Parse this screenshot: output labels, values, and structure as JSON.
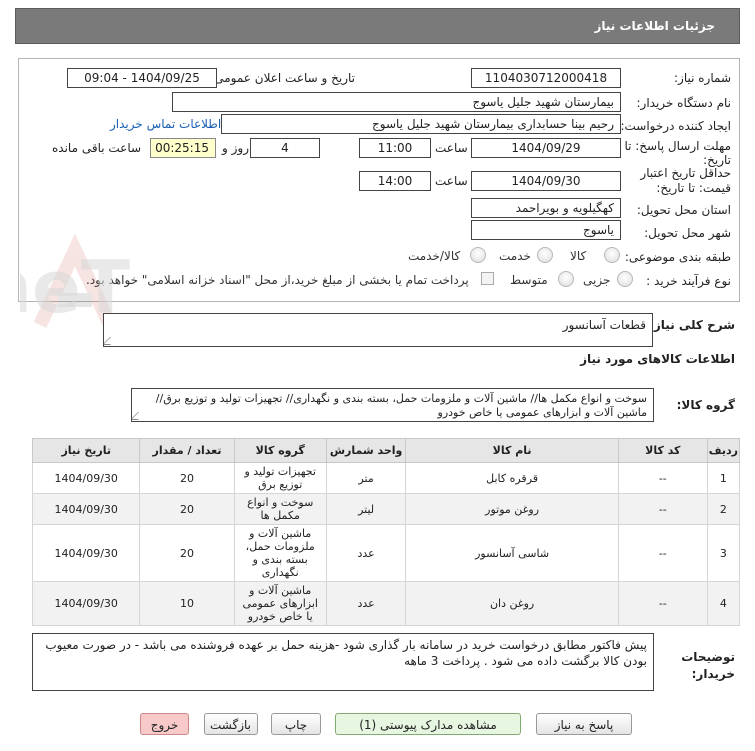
{
  "header": {
    "title": "جزئیات اطلاعات نیاز"
  },
  "form": {
    "need_number_label": "شماره نیاز:",
    "need_number": "1104030712000418",
    "announce_label": "تاریخ و ساعت اعلان عمومی:",
    "announce_value": "1404/09/25 - 09:04",
    "buyer_org_label": "نام دستگاه خریدار:",
    "buyer_org": "بیمارستان شهید جلیل یاسوج",
    "creator_label": "ایجاد کننده درخواست:",
    "creator": "رحیم بینا حسابداری بیمارستان شهید جلیل یاسوج",
    "contact_link": "اطلاعات تماس خریدار",
    "deadline_label_1": "مهلت ارسال پاسخ: تا",
    "deadline_label_2": "تاریخ:",
    "deadline_date": "1404/09/29",
    "time_label": "ساعت",
    "deadline_time": "11:00",
    "days": "4",
    "days_label": "روز و",
    "remaining": "00:25:15",
    "remaining_label": "ساعت باقی مانده",
    "validity_label_1": "حداقل تاریخ اعتبار",
    "validity_label_2": "قیمت: تا تاریخ:",
    "validity_date": "1404/09/30",
    "validity_time": "14:00",
    "province_label": "استان محل تحویل:",
    "province": "کهگیلویه و بویراحمد",
    "city_label": "شهر محل تحویل:",
    "city": "یاسوج",
    "category_label": "طبقه بندی موضوعی:",
    "category_options": [
      "کالا",
      "خدمت",
      "کالا/خدمت"
    ],
    "process_label": "نوع فرآیند خرید :",
    "process_options": [
      "جزیی",
      "متوسط"
    ],
    "payment_note": "پرداخت تمام یا بخشی از مبلغ خرید،از محل \"اسناد خزانه اسلامی\" خواهد بود."
  },
  "summary": {
    "label": "شرح کلی نیاز:",
    "value": "قطعات آسانسور"
  },
  "goods": {
    "section_title": "اطلاعات کالاهای مورد نیاز",
    "group_label": "گروه کالا:",
    "group_value": "سوخت و انواع مکمل ها// ماشین آلات و ملزومات حمل، بسته بندی و نگهداری// تجهیزات تولید و توزیع برق// ماشین آلات و ابزارهای عمومی یا خاص خودرو"
  },
  "table": {
    "headers": [
      "ردیف",
      "کد کالا",
      "نام کالا",
      "واحد شمارش",
      "گروه کالا",
      "تعداد / مقدار",
      "تاریخ نیاز"
    ],
    "rows": [
      [
        "1",
        "--",
        "قرقره کابل",
        "متر",
        "تجهیزات تولید و توزیع برق",
        "20",
        "1404/09/30"
      ],
      [
        "2",
        "--",
        "روغن موتور",
        "لیتر",
        "سوخت و انواع مکمل ها",
        "20",
        "1404/09/30"
      ],
      [
        "3",
        "--",
        "شاسی آسانسور",
        "عدد",
        "ماشین آلات و ملزومات حمل، بسته بندی و نگهداری",
        "20",
        "1404/09/30"
      ],
      [
        "4",
        "--",
        "روغن دان",
        "عدد",
        "ماشین آلات و ابزارهای عمومی یا خاص خودرو",
        "10",
        "1404/09/30"
      ]
    ]
  },
  "notes": {
    "label_1": "توضیحات",
    "label_2": "خریدار:",
    "value": "پیش فاکتور مطابق درخواست خرید در سامانه بار گذاری شود -هزینه حمل بر عهده فروشنده می باشد - در صورت معیوب بودن کالا برگشت داده می شود . پرداخت 3 ماهه"
  },
  "buttons": {
    "reply": "پاسخ به نیاز",
    "attachments": "مشاهده مدارک پیوستی (1)",
    "print": "چاپ",
    "back": "بازگشت",
    "exit": "خروج"
  },
  "watermark": {
    "text": "AriaTender.neT"
  },
  "colors": {
    "title_bar": "#7a7a7a",
    "link": "#1a5fb4",
    "exit_button": "#f7c9c9",
    "attach_button": "#e6f6e0",
    "remaining_bg": "#ffffcc"
  }
}
